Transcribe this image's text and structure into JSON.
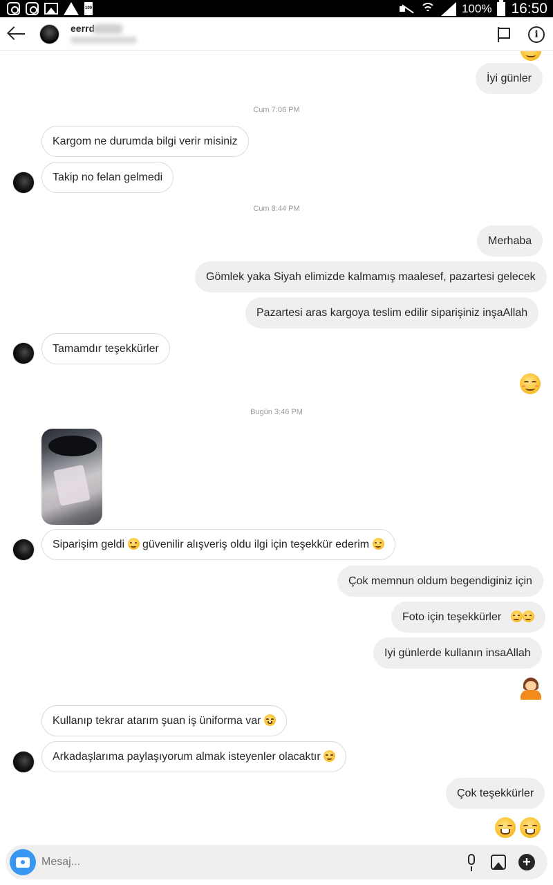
{
  "status_bar": {
    "battery": "100%",
    "time": "16:50",
    "small_battery_label": "100"
  },
  "header": {
    "username": "eerrd",
    "info_glyph": "i"
  },
  "thread": {
    "timestamps": [
      "Cum 7:06 PM",
      "Cum 8:44 PM",
      "Bugün 3:46 PM"
    ],
    "messages": [
      {
        "text": "İyi günler",
        "from": "me"
      },
      {
        "text": "Kargom ne durumda bilgi verir misiniz",
        "from": "them"
      },
      {
        "text": "Takip no felan gelmedi",
        "from": "them"
      },
      {
        "text": "Merhaba",
        "from": "me"
      },
      {
        "text": "Gömlek yaka Siyah elimizde kalmamış maalesef, pazartesi gelecek",
        "from": "me"
      },
      {
        "text": "Pazartesi aras kargoya teslim edilir siparişiniz inşaAllah",
        "from": "me"
      },
      {
        "text": "Tamamdır teşekkürler",
        "from": "them"
      },
      {
        "text": "Siparişim geldi",
        "text2": "güvenilir alışveriş oldu ilgi için teşekkür ederim",
        "from": "them"
      },
      {
        "text": "Çok memnun oldum begendiginiz için",
        "from": "me"
      },
      {
        "text": "Foto için teşekkürler",
        "from": "me"
      },
      {
        "text": "Iyi günlerde kullanın insaAllah",
        "from": "me"
      },
      {
        "text": "Kullanıp tekrar atarım şuan iş üniforma var",
        "from": "them"
      },
      {
        "text": "Arkadaşlarıma paylaşıyorum almak isteyenler olacaktır",
        "from": "them"
      },
      {
        "text": "Çok teşekkürler",
        "from": "me"
      }
    ],
    "emojis": [
      "smiling-face",
      "blushing-face",
      "grinning-face",
      "person-bowing"
    ]
  },
  "composer": {
    "placeholder": "Mesaj..."
  },
  "colors": {
    "accent": "#3897f0",
    "bubble_out": "#efefef",
    "bubble_in_border": "#dbdbdb",
    "timestamp": "#999999"
  }
}
